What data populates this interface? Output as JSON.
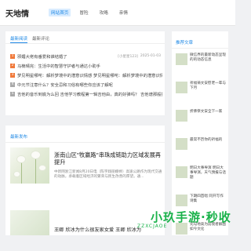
{
  "header": {
    "logo": "天地情",
    "nav": [
      "网站首页",
      "冒险",
      "攻略",
      "亲情"
    ]
  },
  "tabs": [
    "最新阅读",
    "最新评论"
  ],
  "news": [
    {
      "num": "1",
      "title": "邪媚大佬有番爱和谁结婚了",
      "author": "[小星星123]",
      "date": "2025-01-03"
    },
    {
      "num": "2",
      "title": "马楠晴完：生活中的智慧守护者与通达小助手",
      "author": "",
      "date": ""
    },
    {
      "num": "3",
      "title": "梦见明星哪咤：解析梦境中的潜意识情感 梦见明星哪咤：解析梦境中的潜意识情感",
      "author": "",
      "date": ""
    },
    {
      "num": "4",
      "title": "中元节注意什么？安全忌和习俗有哪些你应该了解呢",
      "author": "",
      "date": ""
    },
    {
      "num": "5",
      "title": "吉他的音乐到底为么回 吉他学习教程第一辑吉他由，真的好弹吗？ 吉他谱那般指悉音运吧",
      "author": "",
      "date": ""
    }
  ],
  "section": {
    "title": "最新发布"
  },
  "article": {
    "title": "浙南山区\"牧赢路\"串珠成链助力区域发展再提升",
    "summary": "中新网浙江新闻8月20日电（陈宇翔丽娜婷）高速公路作为现代交通的动脉，承载着区域经济的繁荣与民生改善的厚望。通..."
  },
  "article2": {
    "title": "王卿 欣冰为什么很友家女爱 王卿 欣冰为"
  },
  "sidebar": {
    "title": "推荐文章",
    "items": [
      "微信界的最新动态呈现的的动态信息",
      "祈福祷文安慰老一辈与下月",
      "折佛祭文安全下一家",
      "最常不历你的祈福的",
      "明日大事导演 明日大事导演，天气预报与话题",
      "下期四首唱 同开写作诗集",
      "先勾地高为前夜者解图如今文化",
      "爱穿下什么点"
    ]
  },
  "watermark": {
    "main": "小玖手游·秒收",
    "sub": "ZZXCJAOE"
  }
}
